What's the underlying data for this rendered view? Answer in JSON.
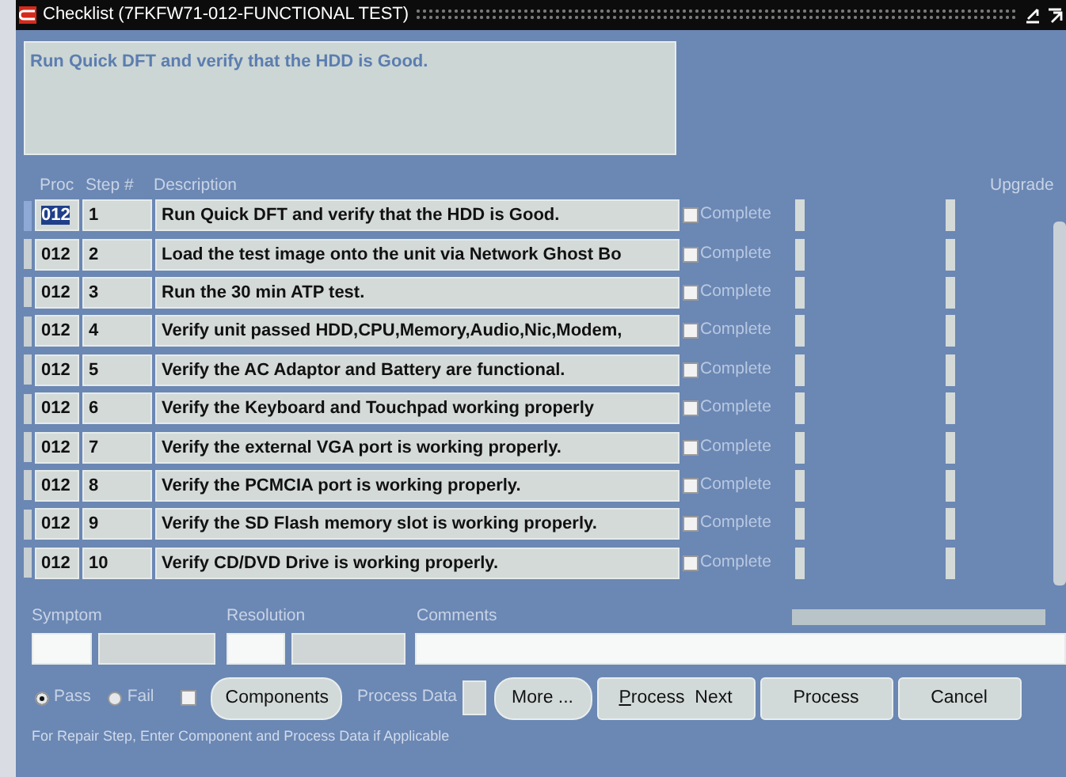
{
  "window": {
    "title": "Checklist (7FKFW71-012-FUNCTIONAL TEST)"
  },
  "prompt": {
    "text": "Run Quick DFT and verify that the HDD is Good."
  },
  "table": {
    "columns": [
      "Proc",
      "Step #",
      "Description",
      "Upgrade"
    ],
    "rows": [
      {
        "proc": "012",
        "step": "1",
        "description": "Run Quick DFT and verify that the HDD is Good.",
        "complete_label": "Complete",
        "complete": false,
        "selected": true
      },
      {
        "proc": "012",
        "step": "2",
        "description": "Load the test image onto the unit via Network Ghost Bo",
        "complete_label": "Complete",
        "complete": false,
        "selected": false
      },
      {
        "proc": "012",
        "step": "3",
        "description": "Run the 30 min ATP test.",
        "complete_label": "Complete",
        "complete": false,
        "selected": false
      },
      {
        "proc": "012",
        "step": "4",
        "description": "Verify unit passed HDD,CPU,Memory,Audio,Nic,Modem,",
        "complete_label": "Complete",
        "complete": false,
        "selected": false
      },
      {
        "proc": "012",
        "step": "5",
        "description": "Verify the AC Adaptor and Battery are functional.",
        "complete_label": "Complete",
        "complete": false,
        "selected": false
      },
      {
        "proc": "012",
        "step": "6",
        "description": "Verify the Keyboard and Touchpad working properly",
        "complete_label": "Complete",
        "complete": false,
        "selected": false
      },
      {
        "proc": "012",
        "step": "7",
        "description": "Verify the external VGA port is working properly.",
        "complete_label": "Complete",
        "complete": false,
        "selected": false
      },
      {
        "proc": "012",
        "step": "8",
        "description": "Verify the PCMCIA port is working properly.",
        "complete_label": "Complete",
        "complete": false,
        "selected": false
      },
      {
        "proc": "012",
        "step": "9",
        "description": "Verify the SD Flash memory slot is working properly.",
        "complete_label": "Complete",
        "complete": false,
        "selected": false
      },
      {
        "proc": "012",
        "step": "10",
        "description": "Verify CD/DVD Drive is working properly.",
        "complete_label": "Complete",
        "complete": false,
        "selected": false
      }
    ]
  },
  "labels": {
    "symptom": "Symptom",
    "resolution": "Resolution",
    "comments": "Comments"
  },
  "result": [
    {
      "label": "Pass",
      "selected": true
    },
    {
      "label": "Fail",
      "selected": false
    }
  ],
  "components": {
    "checked": false,
    "label": "Components"
  },
  "process_data": {
    "label": "Process Data"
  },
  "buttons": [
    {
      "label": "More ..."
    },
    {
      "label": "**P**rocess  Next"
    },
    {
      "label": "Process"
    },
    {
      "label": "Cancel"
    }
  ],
  "hint": "For Repair Step, Enter Component and Process Data if Applicable"
}
